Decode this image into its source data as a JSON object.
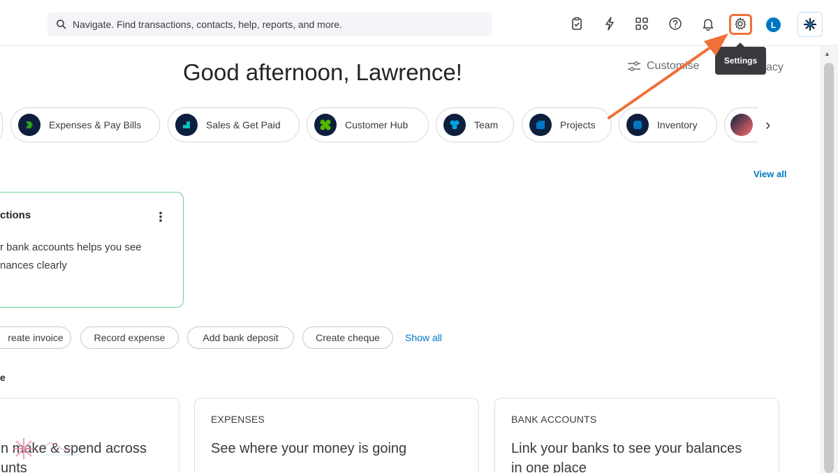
{
  "topbar": {
    "search_placeholder": "Navigate. Find transactions, contacts, help, reports, and more.",
    "icons": [
      "clipboard-icon",
      "lightning-icon",
      "apps-icon",
      "help-icon",
      "bell-icon",
      "gear-icon"
    ],
    "avatar_initial": "L",
    "settings_tooltip": "Settings"
  },
  "header": {
    "greeting": "Good afternoon, Lawrence!",
    "customise_label": "Customise",
    "privacy_label": "acy"
  },
  "apps": [
    {
      "label": "Expenses & Pay Bills",
      "color": "#2ca01c"
    },
    {
      "label": "Sales & Get Paid",
      "color": "#00c1bf"
    },
    {
      "label": "Customer Hub",
      "color": "#53b700"
    },
    {
      "label": "Team",
      "color": "#00a6e0"
    },
    {
      "label": "Projects",
      "color": "#0077c5"
    },
    {
      "label": "Inventory",
      "color": "#0077c5"
    }
  ],
  "tasks": {
    "view_all": "View all",
    "card": {
      "title": "ctions",
      "description_line1": "r bank accounts helps you see",
      "description_line2": "nances clearly"
    }
  },
  "shortcuts": {
    "items": [
      "reate invoice",
      "Record expense",
      "Add bank deposit",
      "Create cheque"
    ],
    "show_all": "Show all"
  },
  "section_label": "e",
  "cards": [
    {
      "label": "",
      "text_line1": "n make & spend across",
      "text_line2": "unts"
    },
    {
      "label": "EXPENSES",
      "text_line1": "See where your money is going",
      "text_line2": ""
    },
    {
      "label": "BANK ACCOUNTS",
      "text_line1": "Link your banks to see your balances",
      "text_line2": "in one place"
    }
  ],
  "colors": {
    "accent": "#0077c5",
    "highlight": "#f07039",
    "dark": "#0d1f3c"
  }
}
